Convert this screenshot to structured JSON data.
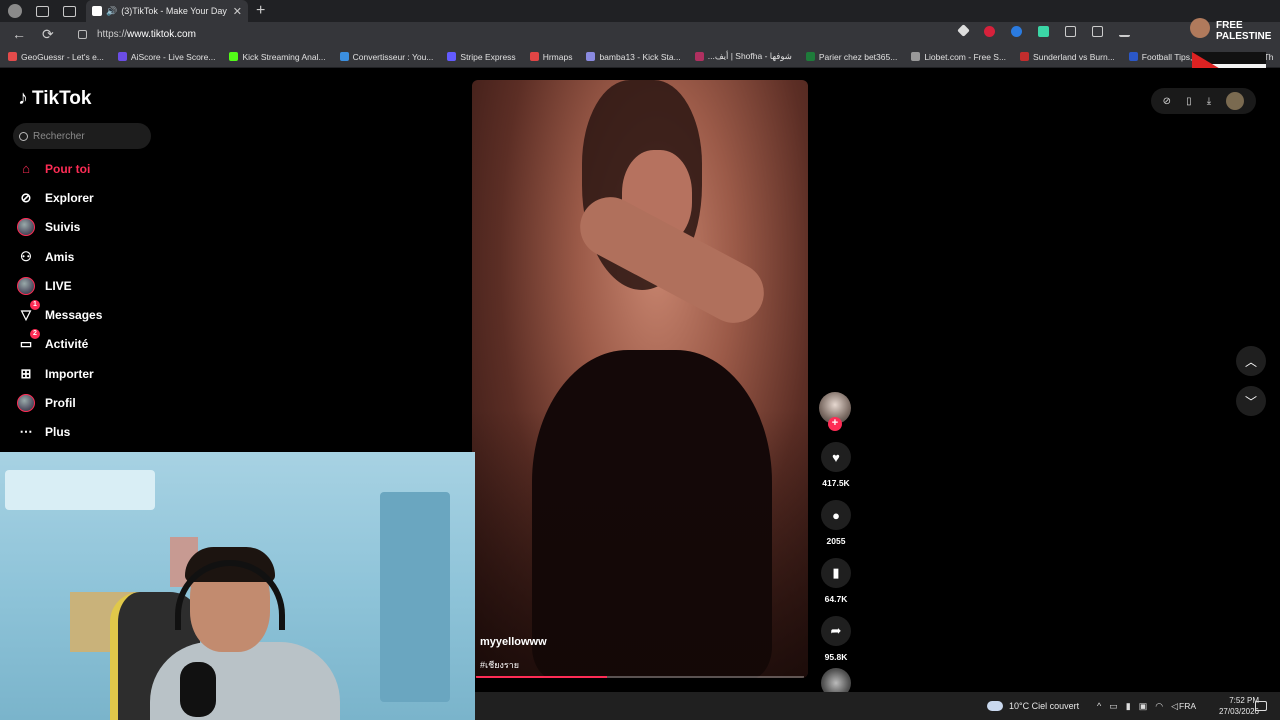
{
  "browser": {
    "tab_title": "(3)TikTok - Make Your Day",
    "url_protocol": "https://",
    "url_domain": "www.tiktok.com",
    "bookmarks": [
      {
        "label": "GeoGuessr - Let's e...",
        "color": "#e34b4b"
      },
      {
        "label": "AiScore - Live Score...",
        "color": "#6b4de6"
      },
      {
        "label": "Kick Streaming Anal...",
        "color": "#53fc18"
      },
      {
        "label": "Convertisseur : You...",
        "color": "#3b8fe0"
      },
      {
        "label": "Stripe Express",
        "color": "#635bff"
      },
      {
        "label": "Hrmaps",
        "color": "#e04545"
      },
      {
        "label": "bamba13 - Kick Sta...",
        "color": "#8a8ae0"
      },
      {
        "label": "...أيف | Shofha - شوفها",
        "color": "#b03060"
      },
      {
        "label": "Parier chez bet365...",
        "color": "#1e7b3a"
      },
      {
        "label": "Liobet.com - Free S...",
        "color": "#999999"
      },
      {
        "label": "Sunderland vs Burn...",
        "color": "#c22d2d"
      },
      {
        "label": "Football Tips, Predi...",
        "color": "#2b57c7"
      },
      {
        "label": "Bet Th",
        "color": "#22aa66"
      }
    ],
    "flag_text": "FREE PALESTINE"
  },
  "sidebar": {
    "logo": "TikTok",
    "search_placeholder": "Rechercher",
    "items": [
      {
        "label": "Pour toi",
        "icon": "home-icon",
        "active": true
      },
      {
        "label": "Explorer",
        "icon": "compass-icon"
      },
      {
        "label": "Suivis",
        "icon": "following-avatar-icon"
      },
      {
        "label": "Amis",
        "icon": "friends-icon"
      },
      {
        "label": "LIVE",
        "icon": "live-avatar-icon"
      },
      {
        "label": "Messages",
        "icon": "messages-icon",
        "badge": "1"
      },
      {
        "label": "Activité",
        "icon": "activity-icon",
        "badge": "2"
      },
      {
        "label": "Importer",
        "icon": "upload-icon"
      },
      {
        "label": "Profil",
        "icon": "profile-avatar-icon"
      },
      {
        "label": "Plus",
        "icon": "more-icon"
      }
    ]
  },
  "video": {
    "author": "myyellowww",
    "hashtag": "#เชียงราย",
    "progress": 0.4
  },
  "actions": {
    "likes": "417.5K",
    "comments": "2055",
    "saves": "64.7K",
    "shares": "95.8K"
  },
  "taskbar": {
    "weather": "10°C Ciel couvert",
    "lang": "FRA",
    "time": "7:52 PM",
    "date": "27/03/2026"
  },
  "colors": {
    "accent": "#fe2c55",
    "background": "#000000"
  }
}
